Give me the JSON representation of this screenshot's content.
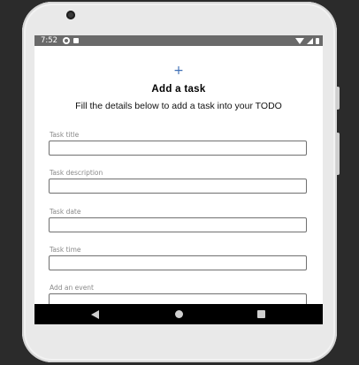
{
  "status_bar": {
    "time": "7:52"
  },
  "page": {
    "add_icon": "+",
    "title": "Add a task",
    "subtitle": "Fill the details below to add a task into your TODO"
  },
  "form": {
    "fields": [
      {
        "label": "Task title",
        "value": "",
        "placeholder": ""
      },
      {
        "label": "Task description",
        "value": "",
        "placeholder": ""
      },
      {
        "label": "Task date",
        "value": "",
        "placeholder": ""
      },
      {
        "label": "Task time",
        "value": "",
        "placeholder": ""
      },
      {
        "label": "Add an event",
        "value": "",
        "placeholder": ""
      }
    ]
  },
  "icons": {
    "status": [
      "app-notification-icon",
      "notification-square-icon",
      "wifi-icon",
      "signal-icon",
      "battery-icon"
    ],
    "nav": [
      "back-icon",
      "home-icon",
      "recents-icon"
    ]
  },
  "colors": {
    "accent": "#3f6fb5",
    "status_bar": "#6a6a6a",
    "nav_bar": "#000000",
    "label": "#8a8a8a"
  }
}
